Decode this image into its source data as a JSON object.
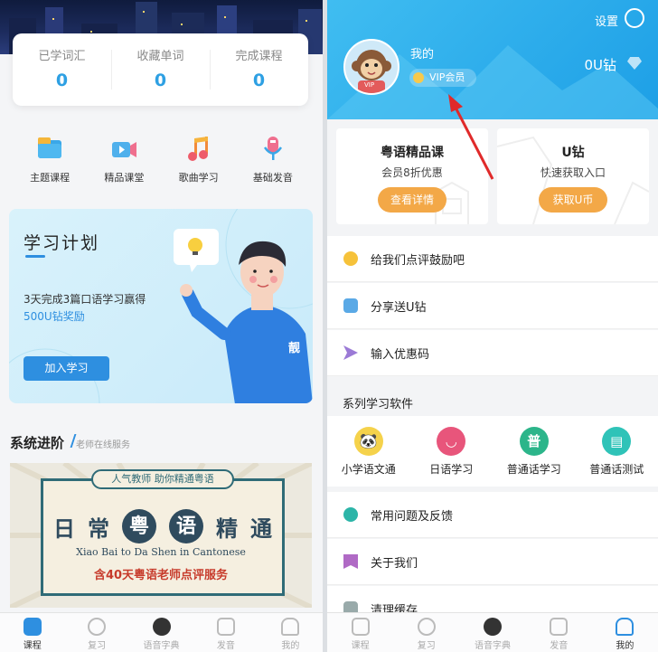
{
  "left": {
    "stats": [
      {
        "label": "已学词汇",
        "value": "0"
      },
      {
        "label": "收藏单词",
        "value": "0"
      },
      {
        "label": "完成课程",
        "value": "0"
      }
    ],
    "categories": [
      {
        "label": "主题课程",
        "icon": "folder-icon"
      },
      {
        "label": "精品课堂",
        "icon": "video-icon"
      },
      {
        "label": "歌曲学习",
        "icon": "music-note-icon"
      },
      {
        "label": "基础发音",
        "icon": "microphone-icon"
      }
    ],
    "plan": {
      "title": "学习计划",
      "desc_line1": "3天完成3篇口语学习赢得",
      "desc_line2": "500U钻奖励",
      "button": "加入学习",
      "hoodie_text": "靓"
    },
    "section": {
      "title": "系统进阶",
      "subtitle": "老师在线服务"
    },
    "banner": {
      "tag": "人气教师 助你精通粤语",
      "chars": [
        "日",
        "常",
        "粤",
        "语",
        "精",
        "通"
      ],
      "english": "Xiao Bai to Da Shen in Cantonese",
      "red_line": "含40天粤语老师点评服务"
    },
    "tabs": [
      {
        "label": "课程",
        "active": true
      },
      {
        "label": "复习",
        "active": false
      },
      {
        "label": "语音字典",
        "active": false
      },
      {
        "label": "发音",
        "active": false
      },
      {
        "label": "我的",
        "active": false
      }
    ]
  },
  "right": {
    "settings": "设置",
    "profile": {
      "name": "我的",
      "vip": "VIP会员",
      "coins": "0U钻",
      "avatar_badge": "VIP"
    },
    "promos": [
      {
        "title": "粤语精品课",
        "sub": "会员8折优惠",
        "button": "查看详情"
      },
      {
        "title": "U钻",
        "sub": "快速获取入口",
        "button": "获取U币"
      }
    ],
    "menu1": [
      {
        "label": "给我们点评鼓励吧",
        "icon": "smiley-icon",
        "color": "#f6c23a"
      },
      {
        "label": "分享送U钻",
        "icon": "share-icon",
        "color": "#5aa9e6"
      },
      {
        "label": "输入优惠码",
        "icon": "paper-plane-icon",
        "color": "#9b7ad6"
      }
    ],
    "series_title": "系列学习软件",
    "apps": [
      {
        "label": "小学语文通",
        "color": "#f5d24b",
        "glyph": "🐼"
      },
      {
        "label": "日语学习",
        "color": "#e8557b",
        "glyph": "◡"
      },
      {
        "label": "普通话学习",
        "color": "#2cb58a",
        "glyph": "普"
      },
      {
        "label": "普通话测试",
        "color": "#2fc3b8",
        "glyph": "▤"
      }
    ],
    "menu2": [
      {
        "label": "常用问题及反馈",
        "icon": "headset-icon",
        "color": "#2cb5a8"
      },
      {
        "label": "关于我们",
        "icon": "bookmark-icon",
        "color": "#b06ac5"
      },
      {
        "label": "清理缓存",
        "icon": "broom-icon",
        "color": "#9aa"
      }
    ],
    "tabs": [
      {
        "label": "课程",
        "active": false
      },
      {
        "label": "复习",
        "active": false
      },
      {
        "label": "语音字典",
        "active": false
      },
      {
        "label": "发音",
        "active": false
      },
      {
        "label": "我的",
        "active": true
      }
    ]
  },
  "colors": {
    "accent": "#2e8fe0",
    "header": "#2aa9ec",
    "orange": "#f3a847",
    "annotation": "#e02a2a"
  }
}
